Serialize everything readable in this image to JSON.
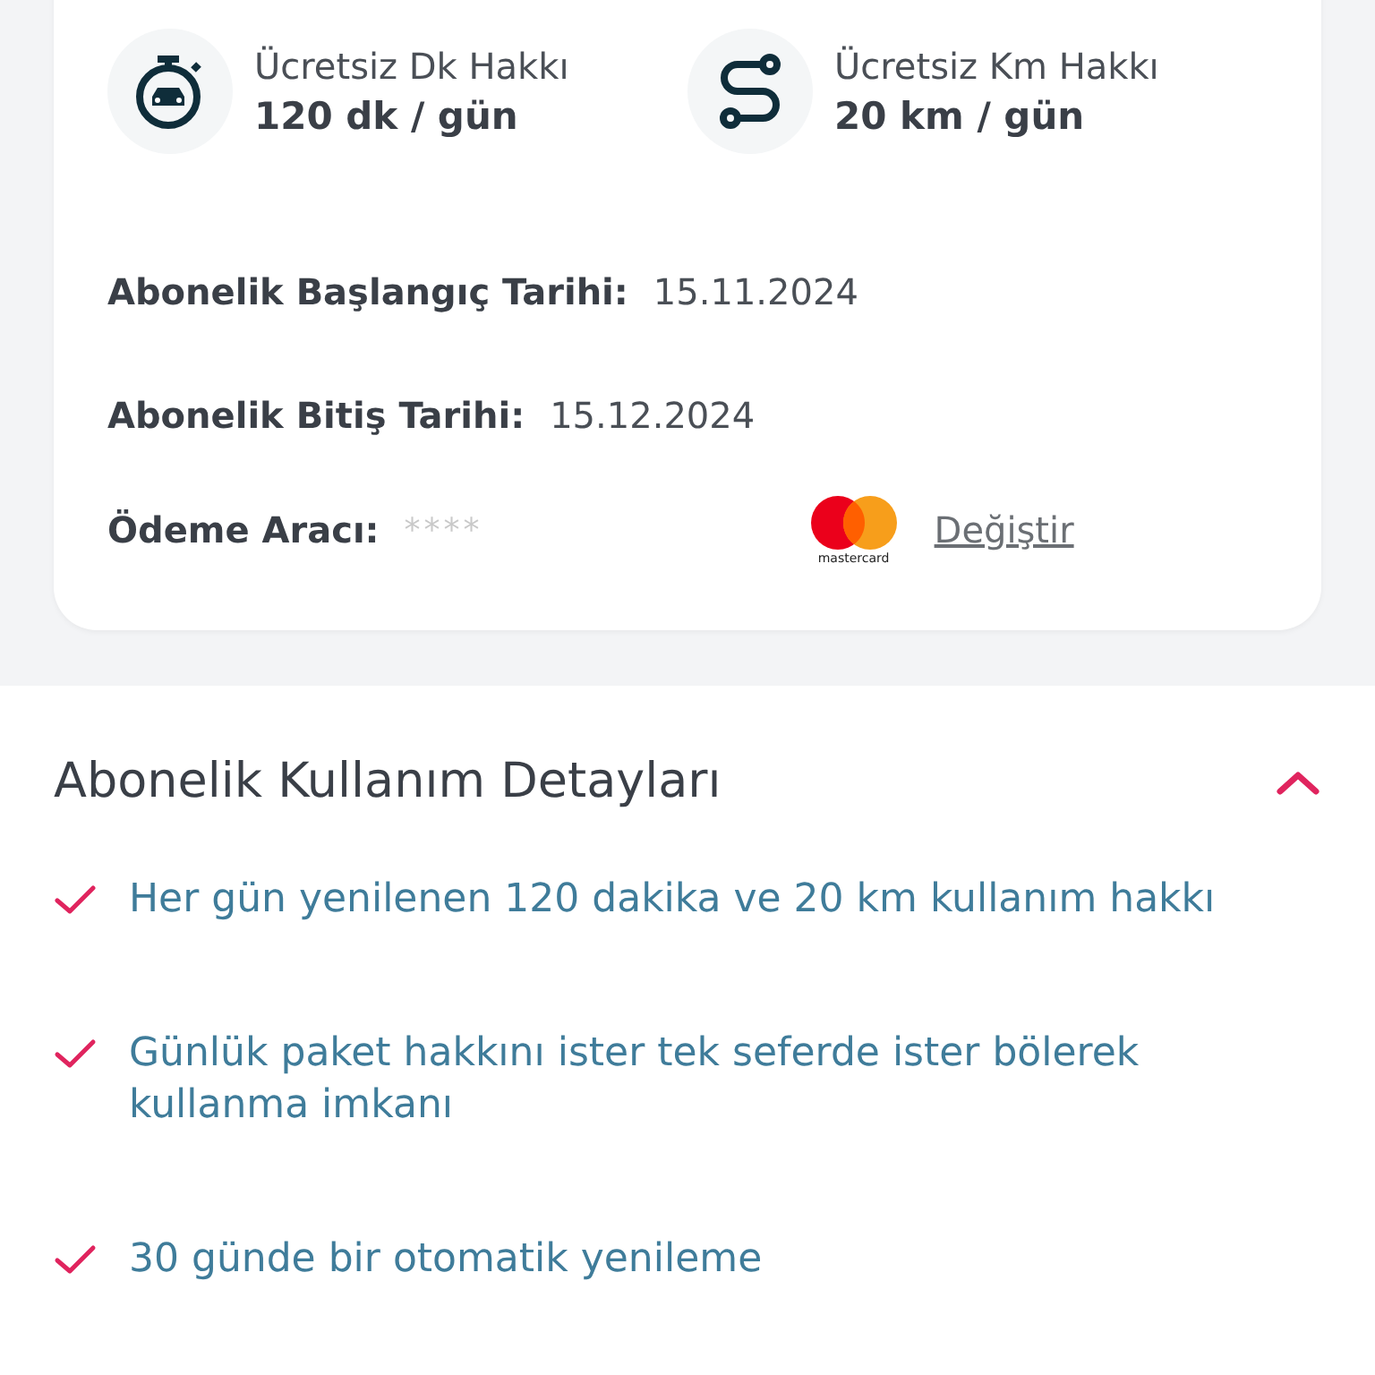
{
  "allowances": [
    {
      "kind": "time",
      "label": "Ücretsiz Dk Hakkı",
      "value": "120 dk / gün"
    },
    {
      "kind": "distance",
      "label": "Ücretsiz Km Hakkı",
      "value": "20 km / gün"
    }
  ],
  "dates": [
    {
      "label": "Abonelik Başlangıç Tarihi:",
      "value": "15.11.2024"
    },
    {
      "label": "Abonelik Bitiş Tarihi:",
      "value": "15.12.2024"
    }
  ],
  "payment": {
    "label": "Ödeme Aracı:",
    "card_number": "****",
    "brand": "mastercard",
    "link": "Değiştir"
  },
  "usage": {
    "title": "Abonelik Kullanım Detayları",
    "expanded": true,
    "items": [
      "Her gün yenilenen 120 dakika ve 20 km kullanım hakkı",
      "Günlük paket hakkını ister tek seferde ister bölerek kullanma imkanı",
      "30 günde bir otomatik yenileme"
    ]
  }
}
